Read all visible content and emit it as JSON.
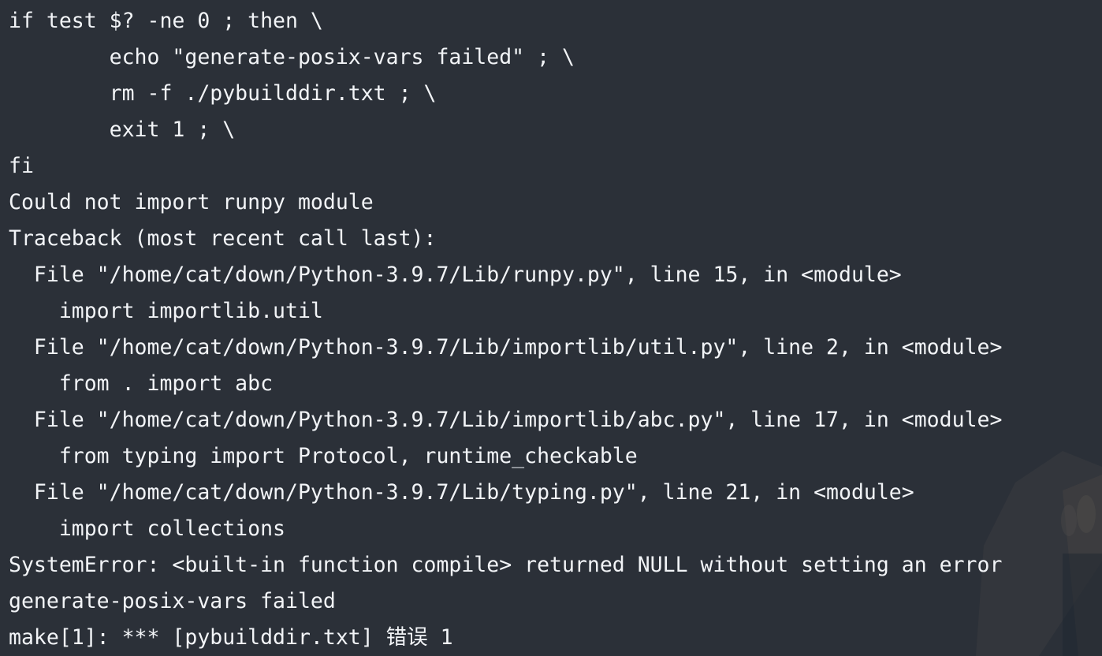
{
  "terminal": {
    "lines": [
      "if test $? -ne 0 ; then \\",
      "        echo \"generate-posix-vars failed\" ; \\",
      "        rm -f ./pybuilddir.txt ; \\",
      "        exit 1 ; \\",
      "fi",
      "Could not import runpy module",
      "Traceback (most recent call last):",
      "  File \"/home/cat/down/Python-3.9.7/Lib/runpy.py\", line 15, in <module>",
      "    import importlib.util",
      "  File \"/home/cat/down/Python-3.9.7/Lib/importlib/util.py\", line 2, in <module>",
      "    from . import abc",
      "  File \"/home/cat/down/Python-3.9.7/Lib/importlib/abc.py\", line 17, in <module>",
      "    from typing import Protocol, runtime_checkable",
      "  File \"/home/cat/down/Python-3.9.7/Lib/typing.py\", line 21, in <module>",
      "    import collections",
      "SystemError: <built-in function compile> returned NULL without setting an error",
      "generate-posix-vars failed",
      "make[1]: *** [pybuilddir.txt] 错误 1"
    ]
  },
  "colors": {
    "background": "#2b3038",
    "text": "#f2f4f7"
  }
}
